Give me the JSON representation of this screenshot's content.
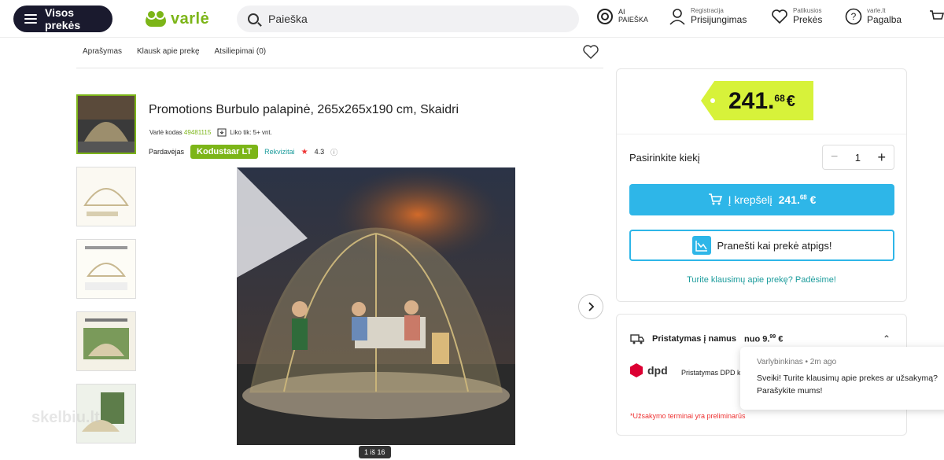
{
  "header": {
    "all_products": "Visos prekės",
    "logo": "varlė",
    "search_placeholder": "Paieška",
    "ai_search_top": "AI",
    "ai_search_bottom": "PAIEŠKA",
    "login_small": "Registracija",
    "login_big": "Prisijungimas",
    "fav_small": "Patikusios",
    "fav_big": "Prekės",
    "help_small": "varle.lt",
    "help_big": "Pagalba"
  },
  "tabs": [
    "Aprašymas",
    "Klausk apie prekę",
    "Atsiliepimai (0)"
  ],
  "product": {
    "title": "Promotions Burbulo palapinė, 265x265x190 cm, Skaidri",
    "code_label": "Varlė kodas",
    "code": "49481115",
    "stock": "Liko tik: 5+ vnt.",
    "seller_label": "Pardavėjas",
    "seller": "Kodustaar LT",
    "requisites": "Rekvizitai",
    "rating": "4.3",
    "image_counter": "1 iš 16"
  },
  "buy_panel": {
    "price_main": "241.",
    "price_cents": "68",
    "currency": "€",
    "qty_label": "Pasirinkite kiekį",
    "qty": "1",
    "cart_label": "Į krepšelį",
    "cart_price": "241.",
    "cart_cents": "68",
    "notify_label": "Pranešti kai prekė atpigs!",
    "help_link": "Turite klausimų apie prekę? Padėsime!"
  },
  "delivery": {
    "label": "Pristatymas į namus",
    "from": "nuo 9.",
    "cents": "99",
    "currency": "€",
    "dpd_logo": "dpd",
    "dpd_text": "Pristatymas DPD k",
    "terms": "*Užsakymo terminai yra preliminarūs"
  },
  "chat": {
    "who": "Varlybinkinas • 2m ago",
    "line1": "Sveiki! Turite klausimų apie prekes ar užsakymą?",
    "line2": "Parašykite mums!"
  },
  "watermark": "skelbiu.lt",
  "colors": {
    "brand_green": "#7cb518",
    "accent_blue": "#2eb6e8",
    "price_yellow": "#d7f23a",
    "teal_link": "#1c9c9c"
  }
}
